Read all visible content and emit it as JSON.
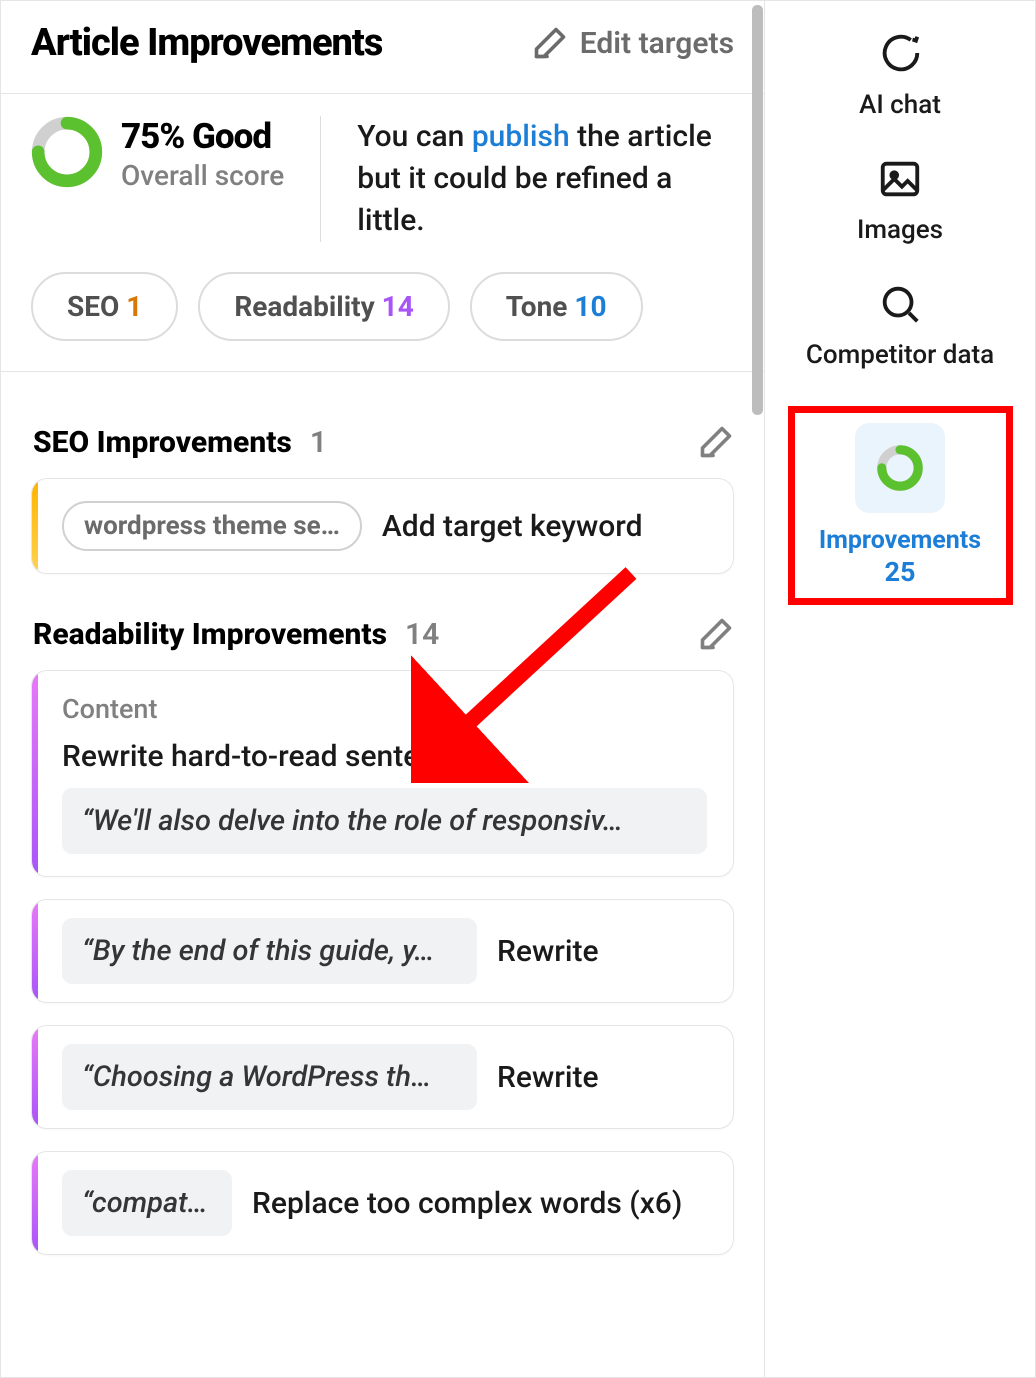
{
  "header": {
    "title": "Article Improvements",
    "edit_targets": "Edit targets"
  },
  "score": {
    "value": "75% Good",
    "subtitle": "Overall score",
    "percent": 75,
    "message_pre": "You can ",
    "message_link": "publish",
    "message_post": " the article but it could be refined a little."
  },
  "pills": {
    "seo": {
      "label": "SEO ",
      "count": "1"
    },
    "readability": {
      "label": "Readability ",
      "count": "14"
    },
    "tone": {
      "label": "Tone ",
      "count": "10"
    }
  },
  "sections": {
    "seo": {
      "title": "SEO Improvements",
      "count": "1",
      "chip": "wordpress theme se…",
      "action": "Add target keyword"
    },
    "readability": {
      "title": "Readability Improvements",
      "count": "14",
      "card1": {
        "subtitle": "Content",
        "heading": "Rewrite hard-to-read sentences.",
        "quote": "“We'll also delve into the role of responsiv…"
      },
      "card2": {
        "quote": "“By the end of this guide, y…",
        "action": "Rewrite"
      },
      "card3": {
        "quote": "“Choosing a WordPress th…",
        "action": "Rewrite"
      },
      "card4": {
        "quote": "“compati…",
        "action": "Replace too complex words  (x6)"
      }
    }
  },
  "sidebar": {
    "ai_chat": "AI chat",
    "images": "Images",
    "competitor": "Competitor data",
    "improvements": {
      "label": "Improvements",
      "count": "25"
    }
  },
  "icons": {
    "pencil": "pencil-icon",
    "chat": "chat-icon",
    "image": "image-icon",
    "search": "search-icon",
    "donut": "donut-icon"
  },
  "colors": {
    "green": "#5cc12f",
    "grey": "#d0d0d0",
    "blue": "#1c7ed6",
    "red_highlight": "#ff0000"
  }
}
